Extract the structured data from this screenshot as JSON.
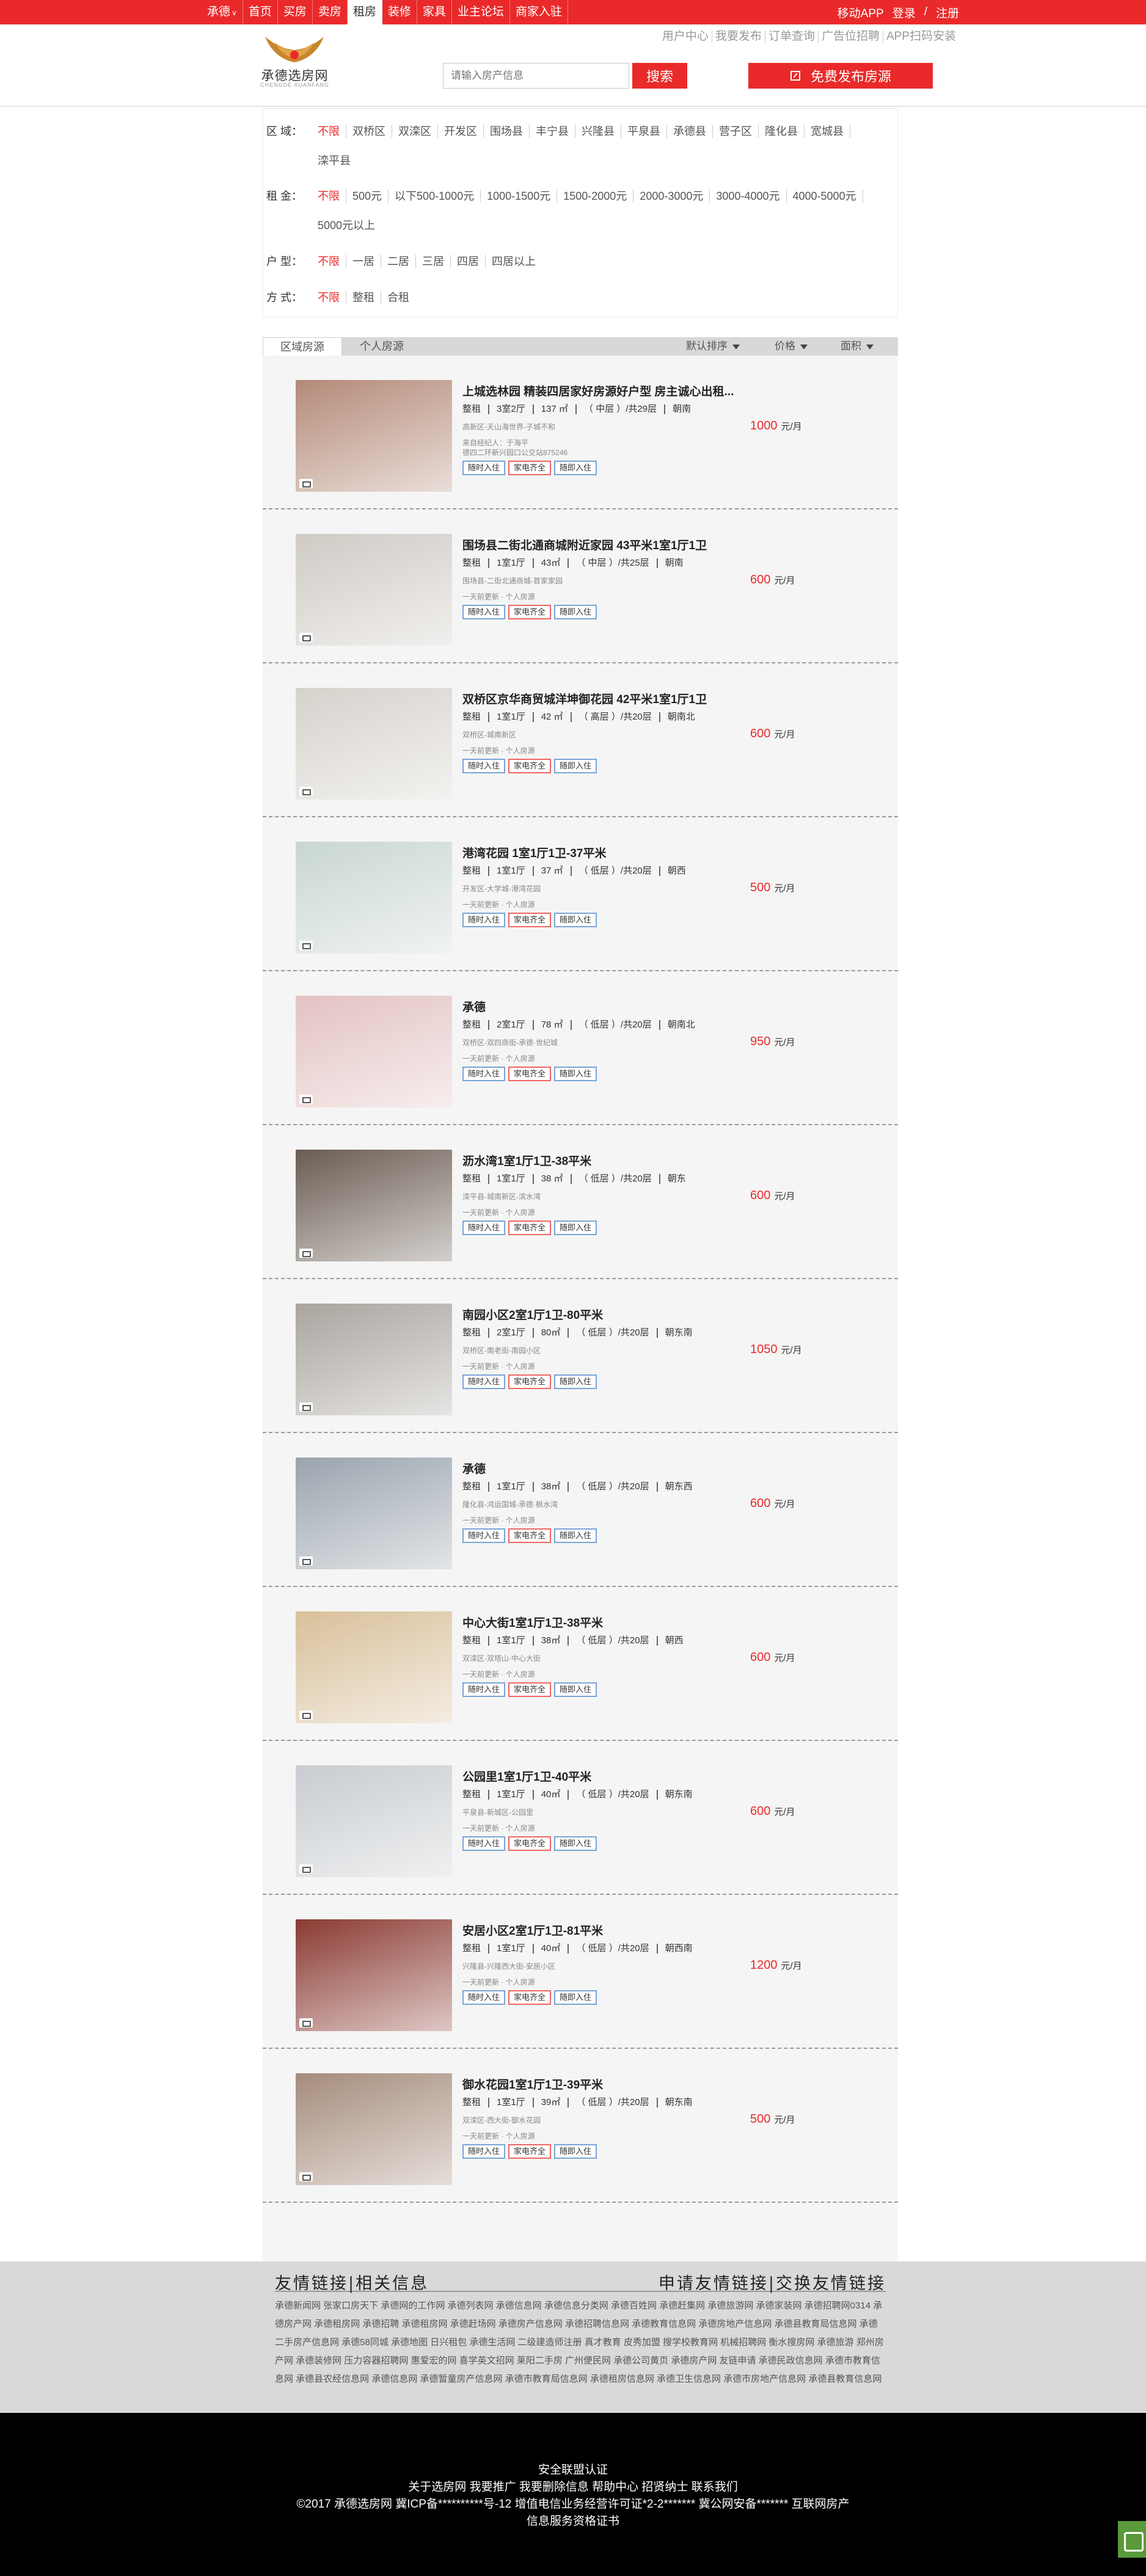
{
  "topbar": {
    "city": "承德",
    "nav": [
      "首页",
      "买房",
      "卖房",
      "租房",
      "装修",
      "家具",
      "业主论坛",
      "商家入驻"
    ],
    "active_index": 3,
    "mobile": "移动APP",
    "login": "登录",
    "sep": "/",
    "register": "注册"
  },
  "header": {
    "logo_name": "承德选房网",
    "logo_sub": "CHENGDE XUANFANG",
    "toplinks": [
      "用户中心",
      "我要发布",
      "订单查询",
      "广告位招聘",
      "APP扫码安装"
    ],
    "search_placeholder": "请输入房产信息",
    "search_button": "搜索",
    "publish_button": "免费发布房源"
  },
  "filters": {
    "region": {
      "label": "区 域：",
      "options": [
        "不限",
        "双桥区",
        "双滦区",
        "开发区",
        "围场县",
        "丰宁县",
        "兴隆县",
        "平泉县",
        "承德县",
        "营子区",
        "隆化县",
        "宽城县",
        "滦平县"
      ]
    },
    "rent": {
      "label": "租 金：",
      "options": [
        "不限",
        "500元",
        "以下500-1000元",
        "1000-1500元",
        "1500-2000元",
        "2000-3000元",
        "3000-4000元",
        "4000-5000元",
        "5000元以上"
      ]
    },
    "layout": {
      "label": "户 型：",
      "options": [
        "不限",
        "一居",
        "二居",
        "三居",
        "四居",
        "四居以上"
      ]
    },
    "mode": {
      "label": "方 式：",
      "options": [
        "不限",
        "整租",
        "合租"
      ]
    }
  },
  "tabs": {
    "agency": "区域房源",
    "personal": "个人房源",
    "sort_default": "默认排序",
    "sort_price": "价格",
    "sort_area": "面积"
  },
  "listings": [
    {
      "title": "上城选林园 精装四居家好房源好户型 房主诚心出租...",
      "specs": [
        "整租",
        "3室2厅",
        "137 ㎡",
        "（ 中层 ）/共29层",
        "朝南"
      ],
      "addr": "高新区-天山海世界-子城不和",
      "contact": "来自经纪人：于海平",
      "extra": "德四二环新兴园口公交站875246",
      "tags": [
        "随时入住",
        "家电齐全",
        "随即入住"
      ],
      "price": "1000",
      "unit": "元/月",
      "photo": "#b48a78"
    },
    {
      "title": "围场县二街北通商城附近家园 43平米1室1厅1卫",
      "specs": [
        "整租",
        "1室1厅",
        "43㎡",
        "（ 中层 ）/共25层",
        "朝南"
      ],
      "addr": "围场县-二街北通商城-首家家园",
      "contact": "一天前更新 · 个人房源",
      "tags": [
        "随时入住",
        "家电齐全",
        "随即入住"
      ],
      "price": "600",
      "unit": "元/月",
      "photo": "#cfcac4"
    },
    {
      "title": "双桥区京华商贸城洋坤御花园 42平米1室1厅1卫",
      "specs": [
        "整租",
        "1室1厅",
        "42 ㎡",
        "（ 高层 ）/共20层",
        "朝南北"
      ],
      "addr": "双桥区-城南新区",
      "contact": "一天前更新 · 个人房源",
      "tags": [
        "随时入住",
        "家电齐全",
        "随即入住"
      ],
      "price": "600",
      "unit": "元/月",
      "photo": "#d6d2cc"
    },
    {
      "title": "港湾花园 1室1厅1卫-37平米",
      "specs": [
        "整租",
        "1室1厅",
        "37 ㎡",
        "（ 低层 ）/共20层",
        "朝西"
      ],
      "addr": "开发区-大学城-港湾花园",
      "contact": "一天前更新 · 个人房源",
      "tags": [
        "随时入住",
        "家电齐全",
        "随即入住"
      ],
      "price": "500",
      "unit": "元/月",
      "photo": "#c9d6d2"
    },
    {
      "title": "承德",
      "specs": [
        "整租",
        "2室1厅",
        "78 ㎡",
        "（ 低层 ）/共20层",
        "朝南北"
      ],
      "addr": "双桥区-双四商街-承德·世纪城",
      "contact": "一天前更新 · 个人房源",
      "tags": [
        "随时入住",
        "家电齐全",
        "随即入住"
      ],
      "price": "950",
      "unit": "元/月",
      "photo": "#e3c2c2"
    },
    {
      "title": "沥水湾1室1厅1卫-38平米",
      "specs": [
        "整租",
        "1室1厅",
        "38 ㎡",
        "（ 低层 ）/共20层",
        "朝东"
      ],
      "addr": "滦平县-城南新区-滨水湾",
      "contact": "一天前更新 · 个人房源",
      "tags": [
        "随时入住",
        "家电齐全",
        "随即入住"
      ],
      "price": "600",
      "unit": "元/月",
      "photo": "#6a5c52"
    },
    {
      "title": "南园小区2室1厅1卫-80平米",
      "specs": [
        "整租",
        "2室1厅",
        "80㎡",
        "（ 低层 ）/共20层",
        "朝东南"
      ],
      "addr": "双桥区-南老街-南园小区",
      "contact": "一天前更新 · 个人房源",
      "tags": [
        "随时入住",
        "家电齐全",
        "随即入住"
      ],
      "price": "1050",
      "unit": "元/月",
      "photo": "#a9a49e"
    },
    {
      "title": "承德",
      "specs": [
        "整租",
        "1室1厅",
        "38㎡",
        "（ 低层 ）/共20层",
        "朝东西"
      ],
      "addr": "隆化县-鸿运国城-承德·枫水湾",
      "contact": "一天前更新 · 个人房源",
      "tags": [
        "随时入住",
        "家电齐全",
        "随即入住"
      ],
      "price": "600",
      "unit": "元/月",
      "photo": "#9aa4ae"
    },
    {
      "title": "中心大街1室1厅1卫-38平米",
      "specs": [
        "整租",
        "1室1厅",
        "38㎡",
        "（ 低层 ）/共20层",
        "朝西"
      ],
      "addr": "双滦区-双塔山-中心大街",
      "contact": "一天前更新 · 个人房源",
      "tags": [
        "随时入住",
        "家电齐全",
        "随即入住"
      ],
      "price": "600",
      "unit": "元/月",
      "photo": "#d8c09a"
    },
    {
      "title": "公园里1室1厅1卫-40平米",
      "specs": [
        "整租",
        "1室1厅",
        "40㎡",
        "（ 低层 ）/共20层",
        "朝东南"
      ],
      "addr": "平泉县-新城区-公园里",
      "contact": "一天前更新 · 个人房源",
      "tags": [
        "随时入住",
        "家电齐全",
        "随即入住"
      ],
      "price": "600",
      "unit": "元/月",
      "photo": "#c8ccd0"
    },
    {
      "title": "安居小区2室1厅1卫-81平米",
      "specs": [
        "整租",
        "1室1厅",
        "40㎡",
        "（ 低层 ）/共20层",
        "朝西南"
      ],
      "addr": "兴隆县-兴隆西大街-安居小区",
      "contact": "一天前更新 · 个人房源",
      "tags": [
        "随时入住",
        "家电齐全",
        "随即入住"
      ],
      "price": "1200",
      "unit": "元/月",
      "photo": "#8a3a32"
    },
    {
      "title": "御水花园1室1厅1卫-39平米",
      "specs": [
        "整租",
        "1室1厅",
        "39㎡",
        "（ 低层 ）/共20层",
        "朝东南"
      ],
      "addr": "双滦区-西大街-御水花园",
      "contact": "一天前更新 · 个人房源",
      "tags": [
        "随时入住",
        "家电齐全",
        "随即入住"
      ],
      "price": "500",
      "unit": "元/月",
      "photo": "#a58c7c"
    }
  ],
  "links": {
    "head_left": "友情链接|相关信息",
    "head_right": "申请友情链接|交换友情链接",
    "body": "承德新闻网 张家口房天下 承德网的工作网 承德列表网 承德信息网 承德信息分类网 承德百姓网 承德赶集网 承德旅游网 承德家装网 承德招聘网0314 承德房产网 承德租房网 承德招聘 承德租房网 承德赶场网 承德房产信息网 承德招聘信息网 承德教育信息网 承德房地产信息网 承德县教育局信息网 承德二手房产信息网 承德58同城 承德地图 日兴租包 承德生活网 二级建造师注册 真才教育 皮秀加盟 搜学校教育网 机械招聘网 衡水搜房网 承德旅游 郑州房产网 承德装修网 压力容器招聘网 惠爱宏的网 喜学英文招网 莱阳二手房 广州便民网 承德公司黄页 承德房产网 友链申请 承德民政信息网 承德市教育信息网 承德县农经信息网 承德信息网 承德暂童房产信息网 承德市教育局信息网 承德租房信息网 承德卫生信息网 承德市房地产信息网 承德县教育信息网"
  },
  "bottom": {
    "line1": "安全联盟认证",
    "line2": "关于选房网 我要推广 我要删除信息 帮助中心 招贤纳士 联系我们",
    "line3": "©2017 承德选房网 冀ICP备**********号-12 增值电信业务经营许可证*2-2******* 冀公网安备******* 互联网房产",
    "line4": "信息服务资格证书"
  }
}
